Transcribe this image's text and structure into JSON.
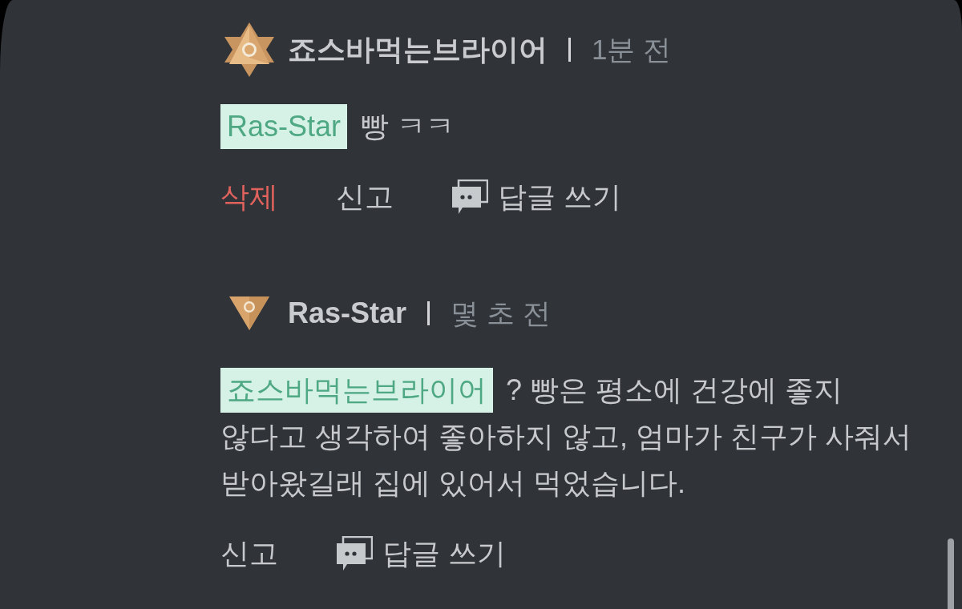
{
  "comments": [
    {
      "author": "죠스바먹는브라이어",
      "time": "1분 전",
      "badge": {
        "kind": "hexagram"
      },
      "mention": "Ras-Star",
      "text": "빵 ㅋㅋ",
      "actions": [
        {
          "kind": "delete",
          "label": "삭제"
        },
        {
          "kind": "report",
          "label": "신고"
        },
        {
          "kind": "reply",
          "label": "답글 쓰기"
        }
      ]
    },
    {
      "author": "Ras-Star",
      "time": "몇 초 전",
      "badge": {
        "kind": "triangle"
      },
      "mention": "죠스바먹는브라이어",
      "text": "? 빵은 평소에 건강에 좋지 않다고 생각하여 좋아하지 않고, 엄마가 친구가 사줘서 받아왔길래 집에 있어서 먹었습니다.",
      "actions": [
        {
          "kind": "report",
          "label": "신고"
        },
        {
          "kind": "reply",
          "label": "답글 쓰기"
        }
      ]
    }
  ]
}
